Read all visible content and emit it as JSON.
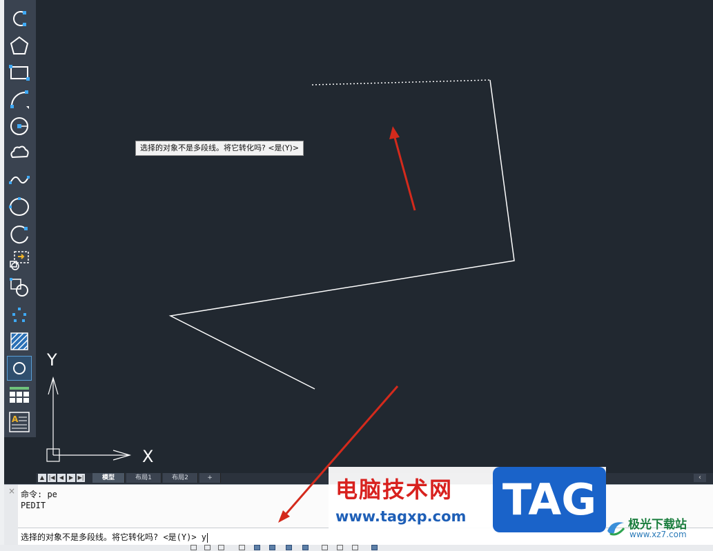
{
  "canvas": {
    "tooltip": "选择的对象不是多段线。将它转化吗? <是(Y)>",
    "ucs": {
      "y_label": "Y",
      "x_label": "X"
    }
  },
  "toolbar": {
    "tools": [
      "arc-icon",
      "polygon-icon",
      "rectangle-icon",
      "arc-3point-icon",
      "circle-icon",
      "revision-cloud-icon",
      "spline-icon",
      "ellipse-icon",
      "ellipse-arc-icon",
      "insert-block-icon",
      "create-block-icon",
      "point-icon",
      "hatch-icon",
      "region-icon",
      "table-icon",
      "multiline-text-icon"
    ],
    "active_tool": "region-icon"
  },
  "tabs": {
    "items": [
      "模型",
      "布局1",
      "布局2",
      "+"
    ],
    "active": "模型",
    "nav": [
      "▲",
      "|◀",
      "◀",
      "▶",
      "▶|"
    ],
    "scroll_left": "‹"
  },
  "command": {
    "history": [
      "命令: pe",
      "PEDIT"
    ],
    "prompt": "选择的对象不是多段线。将它转化吗? <是(Y)> y",
    "close": "×"
  },
  "watermark": {
    "title": "电脑技术网",
    "url": "www.tagxp.com",
    "tag": "TAG",
    "site2_name": "极光下载站",
    "site2_url": "www.xz7.com"
  },
  "colors": {
    "canvas_bg": "#212830",
    "annotation_arrow": "#d42a1c",
    "geometry": "#ffffff"
  }
}
